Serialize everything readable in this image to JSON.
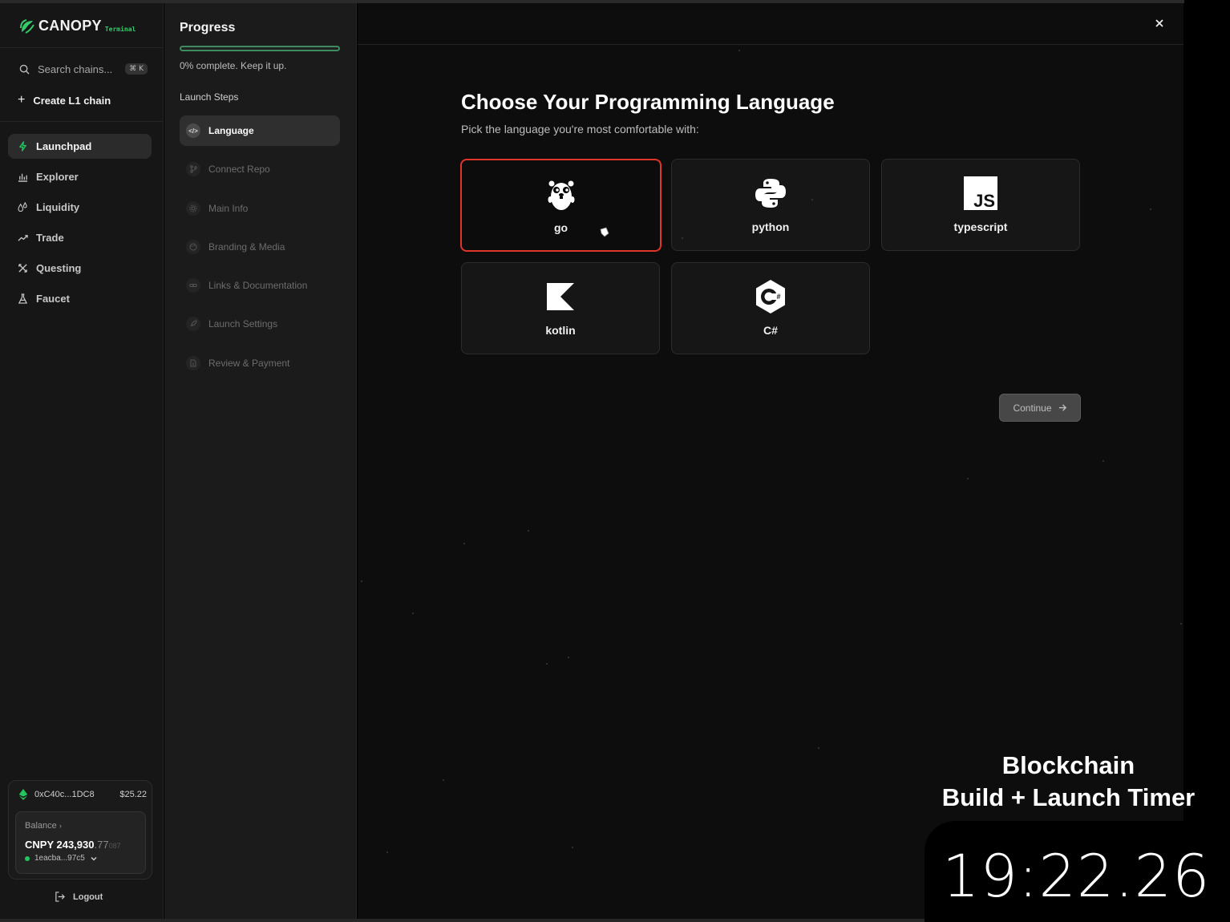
{
  "app": {
    "name": "CANOPY",
    "name_suffix": "Terminal"
  },
  "sidebar": {
    "search_placeholder": "Search chains...",
    "search_shortcut": "⌘ K",
    "create_label": "Create L1 chain",
    "nav": [
      {
        "label": "Launchpad",
        "icon": "bolt-icon",
        "active": true
      },
      {
        "label": "Explorer",
        "icon": "bar-chart-icon"
      },
      {
        "label": "Liquidity",
        "icon": "droplets-icon"
      },
      {
        "label": "Trade",
        "icon": "trend-icon"
      },
      {
        "label": "Questing",
        "icon": "quest-icon"
      },
      {
        "label": "Faucet",
        "icon": "flask-icon"
      }
    ],
    "wallet": {
      "address": "0xC40c...1DC8",
      "usd": "$25.22",
      "balance_label": "Balance",
      "balance_whole": "CNPY 243,930",
      "balance_decimals": ".77",
      "balance_decimals_dim": "087",
      "account": "1eacba...97c5"
    },
    "logout_label": "Logout"
  },
  "progress": {
    "title": "Progress",
    "percent": 0,
    "status": "0% complete. Keep it up.",
    "steps_label": "Launch Steps",
    "steps": [
      {
        "label": "Language",
        "icon": "code-icon",
        "active": true
      },
      {
        "label": "Connect Repo",
        "icon": "git-branch-icon"
      },
      {
        "label": "Main Info",
        "icon": "gear-icon"
      },
      {
        "label": "Branding & Media",
        "icon": "palette-icon"
      },
      {
        "label": "Links & Documentation",
        "icon": "link-icon"
      },
      {
        "label": "Launch Settings",
        "icon": "rocket-icon"
      },
      {
        "label": "Review & Payment",
        "icon": "document-icon"
      }
    ]
  },
  "main": {
    "title": "Choose Your Programming Language",
    "subtitle": "Pick the language you're most comfortable with:",
    "languages": [
      {
        "label": "go",
        "icon": "gopher-icon",
        "selected": true
      },
      {
        "label": "python",
        "icon": "python-icon"
      },
      {
        "label": "typescript",
        "icon": "js-icon"
      },
      {
        "label": "kotlin",
        "icon": "kotlin-icon"
      },
      {
        "label": "C#",
        "icon": "csharp-icon"
      }
    ],
    "continue_label": "Continue"
  },
  "overlay": {
    "title_line1": "Blockchain",
    "title_line2": "Build + Launch Timer",
    "timer": "19:22.26"
  },
  "colors": {
    "accent_green": "#22c55e",
    "selected_border": "#e0352b",
    "progress_green": "#3d8b5e"
  }
}
